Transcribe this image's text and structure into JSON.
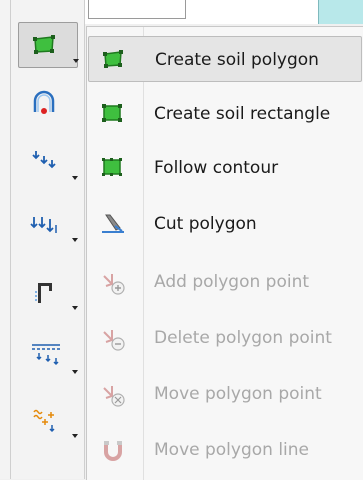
{
  "toolbar": {
    "tools": [
      {
        "name": "create-soil-polygon-tool",
        "icon": "green-polygon-icon",
        "active": true
      },
      {
        "name": "arch-tool",
        "icon": "arch-icon"
      },
      {
        "name": "scatter-points-tool",
        "icon": "scatter-points-icon"
      },
      {
        "name": "load-arrows-tool",
        "icon": "load-arrows-icon"
      },
      {
        "name": "fixity-tool",
        "icon": "fixity-icon"
      },
      {
        "name": "distributed-load-tool",
        "icon": "distributed-load-icon"
      },
      {
        "name": "water-flow-tool",
        "icon": "water-flow-icon"
      }
    ]
  },
  "menu": {
    "items": [
      {
        "label": "Create soil polygon",
        "icon": "green-polygon-icon",
        "enabled": true,
        "active": true
      },
      {
        "label": "Create soil rectangle",
        "icon": "green-rectangle-icon",
        "enabled": true
      },
      {
        "label": "Follow contour",
        "icon": "follow-contour-icon",
        "enabled": true
      },
      {
        "label": "Cut polygon",
        "icon": "cut-polygon-icon",
        "enabled": true
      },
      {
        "label": "Add polygon point",
        "icon": "add-point-icon",
        "enabled": false
      },
      {
        "label": "Delete polygon point",
        "icon": "delete-point-icon",
        "enabled": false
      },
      {
        "label": "Move polygon point",
        "icon": "move-point-icon",
        "enabled": false
      },
      {
        "label": "Move polygon line",
        "icon": "move-line-icon",
        "enabled": false
      }
    ]
  }
}
